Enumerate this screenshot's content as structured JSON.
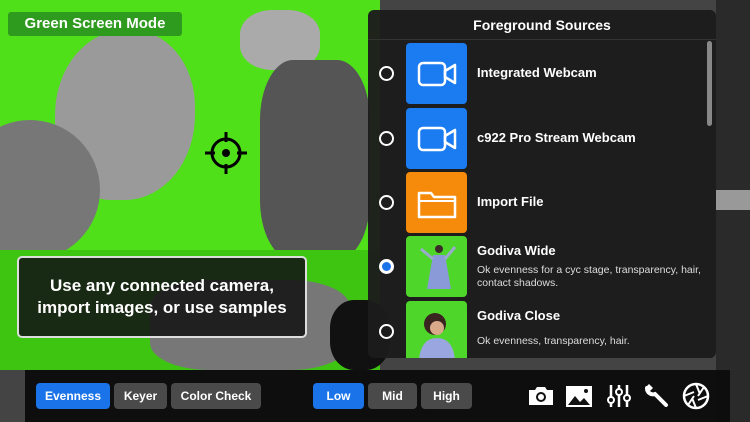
{
  "mode_badge": "Green Screen Mode",
  "info_text": "Use any connected camera, import images, or use samples",
  "panel": {
    "title": "Foreground Sources",
    "items": [
      {
        "name": "Integrated Webcam",
        "description": "",
        "icon": "video-camera-icon",
        "color": "#1a7cf0",
        "selected": false
      },
      {
        "name": "c922 Pro Stream Webcam",
        "description": "",
        "icon": "video-camera-icon",
        "color": "#1a7cf0",
        "selected": false
      },
      {
        "name": "Import File",
        "description": "",
        "icon": "folder-icon",
        "color": "#f58a0b",
        "selected": false
      },
      {
        "name": "Godiva Wide",
        "description": "Ok evenness for a cyc stage, transparency, hair, contact shadows.",
        "icon": "thumbnail",
        "color": "#4fd62a",
        "selected": true
      },
      {
        "name": "Godiva Close",
        "description": "Ok evenness, transparency, hair.",
        "icon": "thumbnail",
        "color": "#4fd62a",
        "selected": false
      }
    ]
  },
  "toolbar": {
    "view_buttons": [
      {
        "label": "Evenness",
        "active": true
      },
      {
        "label": "Keyer",
        "active": false
      },
      {
        "label": "Color Check",
        "active": false
      }
    ],
    "level_buttons": [
      {
        "label": "Low",
        "active": true
      },
      {
        "label": "Mid",
        "active": false
      },
      {
        "label": "High",
        "active": false
      }
    ],
    "tools": [
      "camera-icon",
      "image-icon",
      "sliders-icon",
      "wrench-icon",
      "aperture-icon"
    ]
  },
  "colors": {
    "accent": "#1a73e8",
    "green": "#2e9a1e",
    "chroma": "#4fe01a"
  }
}
